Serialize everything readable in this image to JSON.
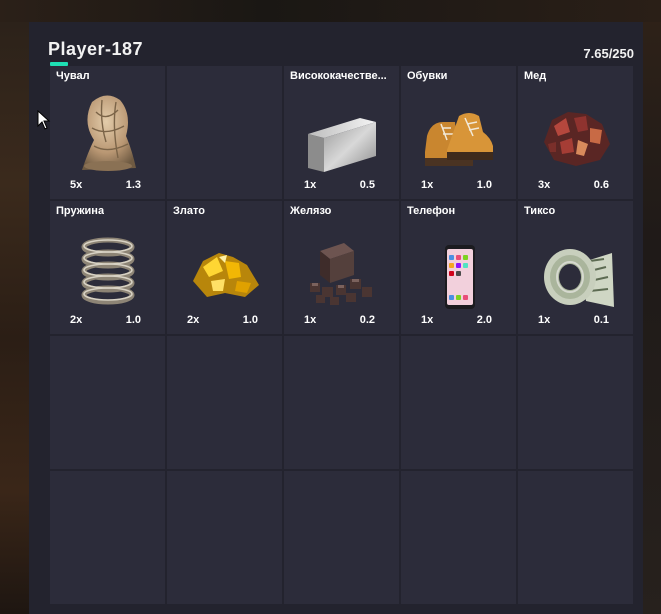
{
  "inventory": {
    "player_name": "Player-187",
    "weight": "7.65/250",
    "accent_color": "#1ee0b4",
    "slots": [
      {
        "name": "Чувал",
        "count": "5x",
        "weight": "1.3",
        "icon": "sack-hood-icon"
      },
      {
        "name": "",
        "count": "",
        "weight": "",
        "icon": ""
      },
      {
        "name": "Висококачестве...",
        "count": "1x",
        "weight": "0.5",
        "icon": "steel-bar-icon"
      },
      {
        "name": "Обувки",
        "count": "1x",
        "weight": "1.0",
        "icon": "boots-icon"
      },
      {
        "name": "Мед",
        "count": "3x",
        "weight": "0.6",
        "icon": "copper-ore-icon"
      },
      {
        "name": "Пружина",
        "count": "2x",
        "weight": "1.0",
        "icon": "spring-icon"
      },
      {
        "name": "Злато",
        "count": "2x",
        "weight": "1.0",
        "icon": "gold-nugget-icon"
      },
      {
        "name": "Желязо",
        "count": "1x",
        "weight": "0.2",
        "icon": "iron-ore-icon"
      },
      {
        "name": "Телефон",
        "count": "1x",
        "weight": "2.0",
        "icon": "phone-icon"
      },
      {
        "name": "Тиксо",
        "count": "1x",
        "weight": "0.1",
        "icon": "tape-roll-icon"
      }
    ]
  }
}
